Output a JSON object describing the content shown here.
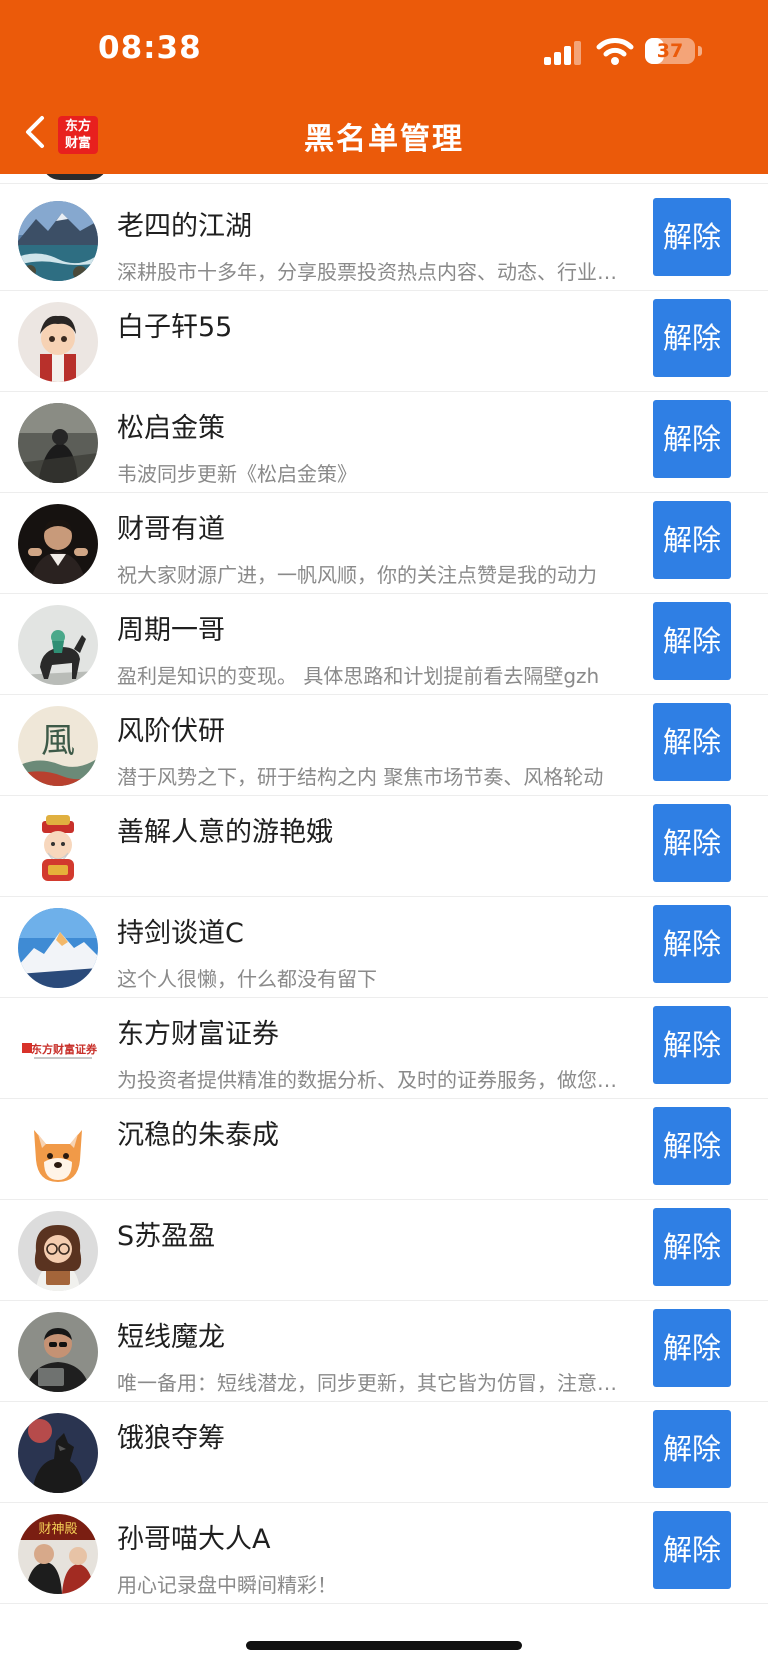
{
  "status": {
    "time": "08:38",
    "battery": "37",
    "battery_level": 0.37
  },
  "header": {
    "title": "黑名单管理",
    "logo_line1": "东方",
    "logo_line2": "财富"
  },
  "unblock_label": "解除",
  "rows": [
    {
      "name": "老四的江湖",
      "desc": "深耕股市十多年，分享股票投资热点内容、动态、行业信息、投资感悟"
    },
    {
      "name": "白子轩55",
      "desc": ""
    },
    {
      "name": "松启金策",
      "desc": "韦波同步更新《松启金策》"
    },
    {
      "name": "财哥有道",
      "desc": "祝大家财源广进，一帆风顺，你的关注点赞是我的动力"
    },
    {
      "name": "周期一哥",
      "desc": "盈利是知识的变现。 具体思路和计划提前看去隔壁gzh"
    },
    {
      "name": "风阶伏研",
      "desc": "潜于风势之下，研于结构之内 聚焦市场节奏、风格轮动"
    },
    {
      "name": "善解人意的游艳娥",
      "desc": ""
    },
    {
      "name": "持剑谈道C",
      "desc": "这个人很懒，什么都没有留下"
    },
    {
      "name": "东方财富证券",
      "desc": "为投资者提供精准的数据分析、及时的证券服务，做您身边的投资顾问"
    },
    {
      "name": "沉稳的朱泰成",
      "desc": ""
    },
    {
      "name": "S苏盈盈",
      "desc": ""
    },
    {
      "name": "短线魔龙",
      "desc": "唯一备用：短线潜龙，同步更新，其它皆为仿冒，注意甄别"
    },
    {
      "name": "饿狼夺筹",
      "desc": ""
    },
    {
      "name": "孙哥喵大人A",
      "desc": "用心记录盘中瞬间精彩！"
    }
  ],
  "avatars": [
    {
      "icon": "mountain-river-avatar-icon"
    },
    {
      "icon": "cartoon-boy-avatar-icon"
    },
    {
      "icon": "dark-figure-avatar-icon"
    },
    {
      "icon": "suit-man-avatar-icon"
    },
    {
      "icon": "horse-rider-avatar-icon"
    },
    {
      "icon": "feng-calligraphy-avatar-icon",
      "glyph": "風"
    },
    {
      "icon": "fortune-god-avatar-icon"
    },
    {
      "icon": "snow-mountain-avatar-icon"
    },
    {
      "icon": "eastmoney-securities-logo-icon",
      "glyph": "东方财富证券"
    },
    {
      "icon": "shiba-dog-avatar-icon"
    },
    {
      "icon": "cartoon-girl-avatar-icon"
    },
    {
      "icon": "man-portrait-avatar-icon"
    },
    {
      "icon": "wolf-avatar-icon"
    },
    {
      "icon": "wealth-banner-avatar-icon",
      "glyph": "财神殿"
    }
  ]
}
